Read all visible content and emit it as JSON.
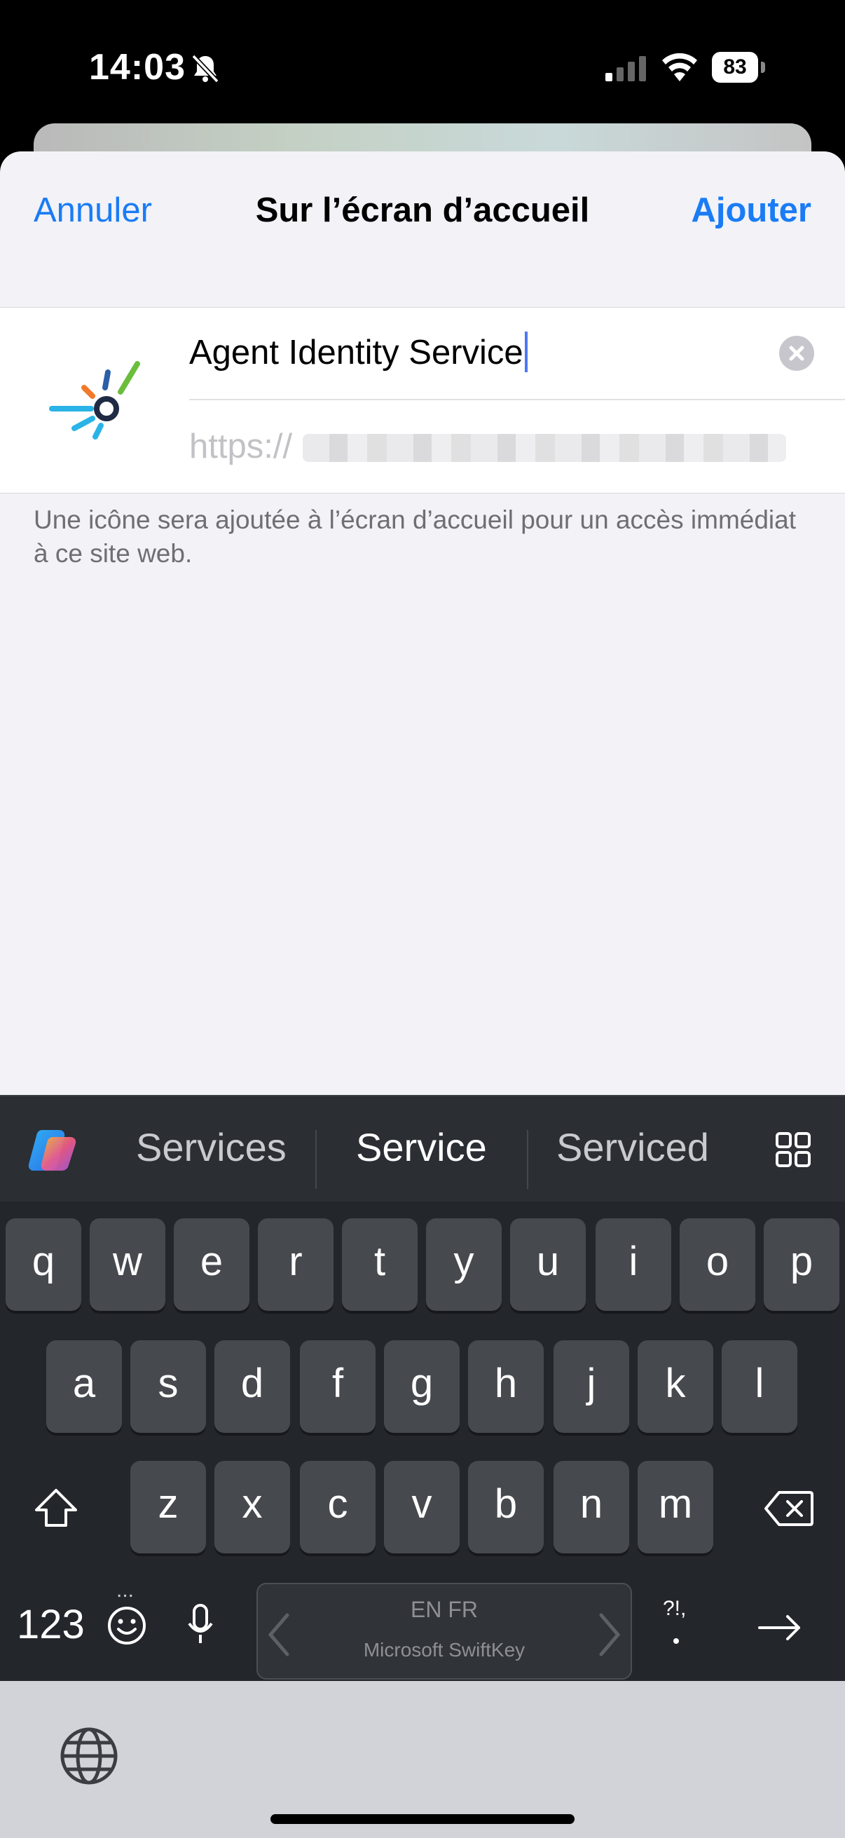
{
  "status_bar": {
    "time": "14:03",
    "battery": "83"
  },
  "nav": {
    "cancel_label": "Annuler",
    "title": "Sur l’écran d’accueil",
    "add_label": "Ajouter"
  },
  "form": {
    "name_value": "Agent Identity Service",
    "url_prefix": "https://",
    "footnote": "Une icône sera ajoutée à l’écran d’accueil pour un accès immédiat à ce site web."
  },
  "keyboard": {
    "suggestions": [
      "Services",
      "Service",
      "Serviced"
    ],
    "row1": [
      "q",
      "w",
      "e",
      "r",
      "t",
      "y",
      "u",
      "i",
      "o",
      "p"
    ],
    "row2": [
      "a",
      "s",
      "d",
      "f",
      "g",
      "h",
      "j",
      "k",
      "l"
    ],
    "row3": [
      "z",
      "x",
      "c",
      "v",
      "b",
      "n",
      "m"
    ],
    "numbers_label": "123",
    "space_languages": "EN FR",
    "space_brand": "Microsoft SwiftKey",
    "punct_label": "?!,",
    "more_label": "..."
  }
}
